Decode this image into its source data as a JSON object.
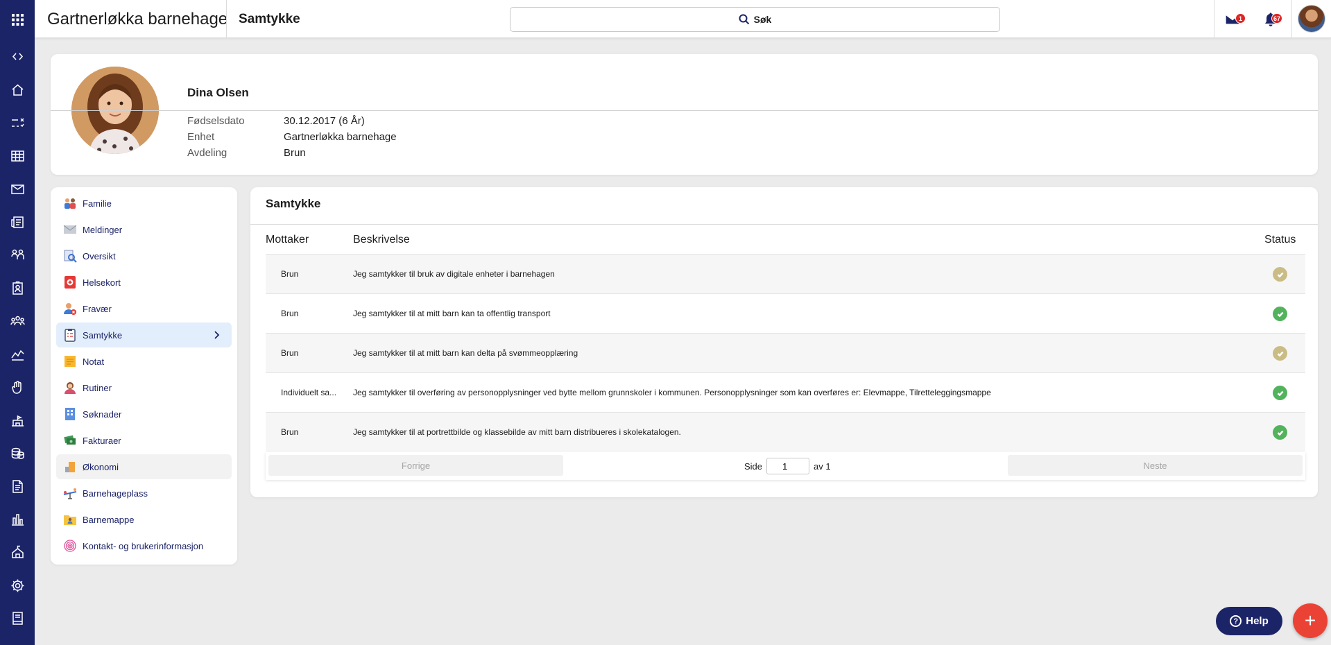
{
  "header": {
    "app_title": "Gartnerløkka barnehage",
    "page_title": "Samtykke",
    "search_label": "Søk",
    "messages_badge": "1",
    "notifications_badge": "67"
  },
  "rail": {
    "icons": [
      "apps-grid-icon",
      "collapse-toggle-icon",
      "home-icon",
      "tasks-icon",
      "calendar-icon",
      "mail-icon",
      "news-icon",
      "groups-icon",
      "badge-icon",
      "people-icon",
      "activity-icon",
      "hand-icon",
      "school-icon",
      "coins-icon",
      "document-icon",
      "chart-icon",
      "building-icon",
      "settings-icon",
      "book-icon"
    ]
  },
  "profile": {
    "name": "Dina Olsen",
    "fields": [
      {
        "key": "Fødselsdato",
        "value": "30.12.2017 (6 År)"
      },
      {
        "key": "Enhet",
        "value": "Gartnerløkka barnehage"
      },
      {
        "key": "Avdeling",
        "value": "Brun"
      }
    ]
  },
  "menu": {
    "items": [
      {
        "label": "Familie",
        "icon": "family-icon"
      },
      {
        "label": "Meldinger",
        "icon": "envelope-icon"
      },
      {
        "label": "Oversikt",
        "icon": "overview-icon"
      },
      {
        "label": "Helsekort",
        "icon": "health-card-icon"
      },
      {
        "label": "Fravær",
        "icon": "absence-icon"
      },
      {
        "label": "Samtykke",
        "icon": "consent-clipboard-icon",
        "active": true
      },
      {
        "label": "Notat",
        "icon": "note-icon"
      },
      {
        "label": "Rutiner",
        "icon": "routines-icon"
      },
      {
        "label": "Søknader",
        "icon": "applications-icon"
      },
      {
        "label": "Fakturaer",
        "icon": "invoices-icon"
      },
      {
        "label": "Økonomi",
        "icon": "economy-icon",
        "hover": true
      },
      {
        "label": "Barnehageplass",
        "icon": "kindergarten-place-icon"
      },
      {
        "label": "Barnemappe",
        "icon": "child-folder-icon"
      },
      {
        "label": "Kontakt- og brukerinformasjon",
        "icon": "contact-info-icon"
      }
    ]
  },
  "consent": {
    "title": "Samtykke",
    "columns": {
      "recipient": "Mottaker",
      "description": "Beskrivelse",
      "status": "Status"
    },
    "rows": [
      {
        "recipient": "Brun",
        "description": "Jeg samtykker til bruk av digitale enheter i barnehagen",
        "status": "pending",
        "status_color": "#c9bd85"
      },
      {
        "recipient": "Brun",
        "description": "Jeg samtykker til at mitt barn kan ta offentlig transport",
        "status": "approved",
        "status_color": "#52b35c"
      },
      {
        "recipient": "Brun",
        "description": "Jeg samtykker til at mitt barn kan delta på svømmeopplæring",
        "status": "pending",
        "status_color": "#c9bd85"
      },
      {
        "recipient": "Individuelt sa...",
        "description": "Jeg samtykker til overføring av personopplysninger ved bytte mellom grunnskoler i kommunen. Personopplysninger som kan overføres er: Elevmappe, Tilretteleggingsmappe",
        "status": "approved",
        "status_color": "#52b35c"
      },
      {
        "recipient": "Brun",
        "description": "Jeg samtykker til at portrettbilde og klassebilde av mitt barn distribueres i skolekatalogen.",
        "status": "approved",
        "status_color": "#52b35c"
      }
    ],
    "pager": {
      "prev": "Forrige",
      "next": "Neste",
      "page_label": "Side",
      "page_value": "1",
      "of_label": "av 1"
    }
  },
  "help_label": "Help",
  "colors": {
    "brand": "#1c2468",
    "accent_red": "#ea4335",
    "approved": "#52b35c",
    "pending": "#c9bd85"
  }
}
